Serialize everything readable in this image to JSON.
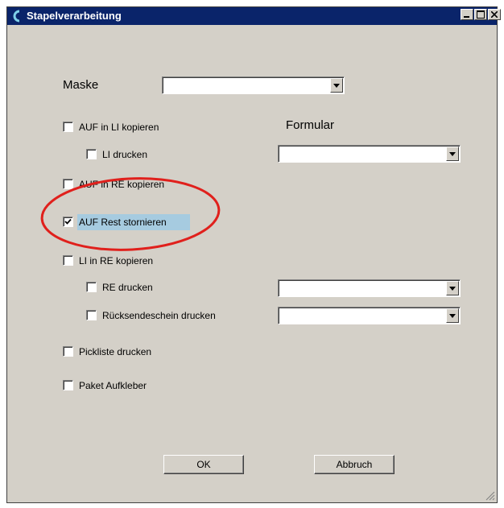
{
  "window": {
    "title": "Stapelverarbeitung",
    "minimize_symbol": "_",
    "maximize_symbol": "□",
    "close_symbol": "✕"
  },
  "form": {
    "maske_label": "Maske",
    "maske_value": "",
    "formular_label": "Formular",
    "checkboxes": [
      {
        "label": "AUF in LI kopieren",
        "checked": false
      },
      {
        "label": "LI drucken",
        "checked": false,
        "formular_value": ""
      },
      {
        "label": "AUF in RE kopieren",
        "checked": false
      },
      {
        "label": "AUF Rest stornieren",
        "checked": true
      },
      {
        "label": "LI in RE kopieren",
        "checked": false
      },
      {
        "label": "RE drucken",
        "checked": false,
        "formular_value": ""
      },
      {
        "label": "Rücksendeschein drucken",
        "checked": false,
        "formular_value": ""
      },
      {
        "label": "Pickliste drucken",
        "checked": false
      },
      {
        "label": "Paket Aufkleber",
        "checked": false
      }
    ]
  },
  "buttons": {
    "ok_label": "OK",
    "cancel_label": "Abbruch"
  },
  "annotation": {
    "type": "red-ellipse",
    "color": "#e0201c",
    "target": "AUF Rest stornieren"
  },
  "colors": {
    "titlebar": "#0a246a",
    "dialog_bg": "#d4d0c8",
    "selection_highlight": "#a6cbe0"
  }
}
